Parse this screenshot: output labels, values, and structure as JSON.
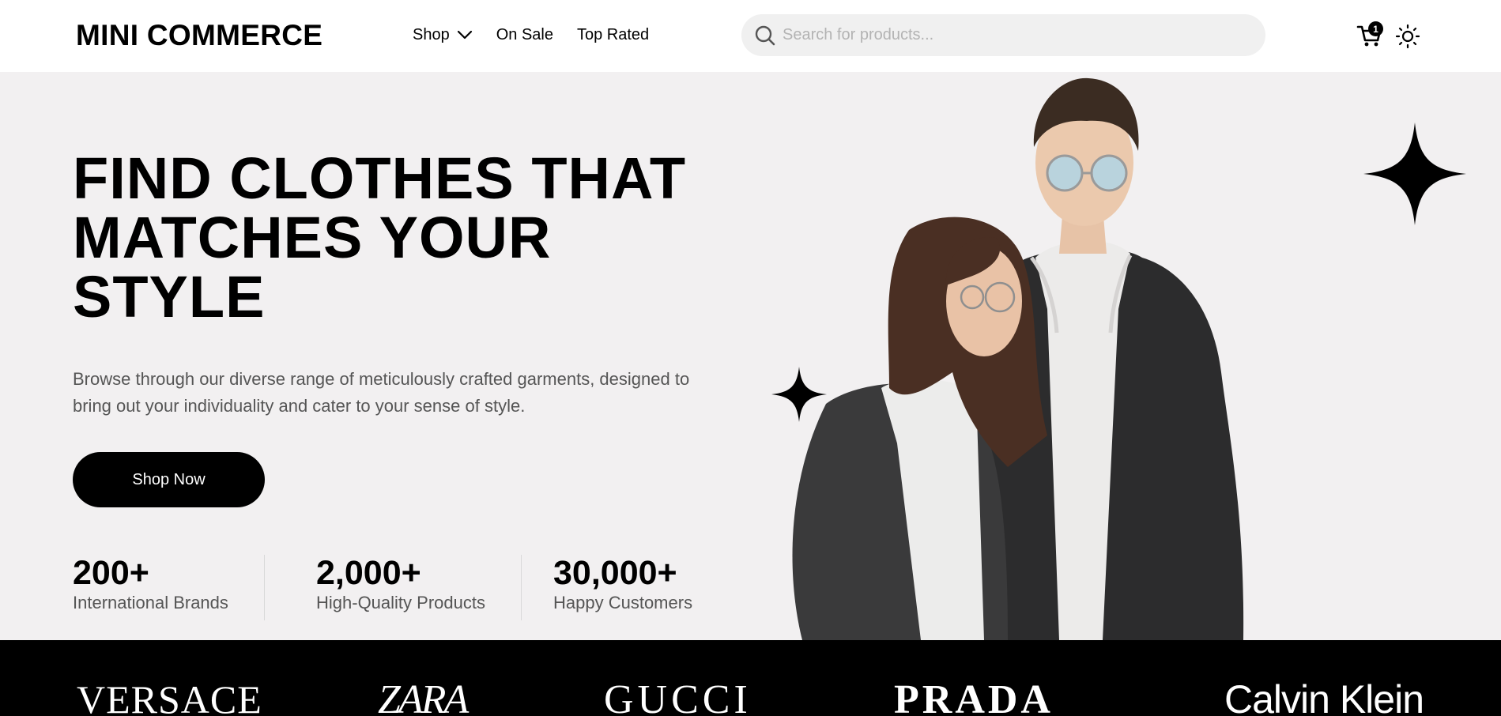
{
  "header": {
    "logo": "MINI COMMERCE",
    "nav": {
      "shop": "Shop",
      "on_sale": "On Sale",
      "top_rated": "Top Rated"
    },
    "search": {
      "placeholder": "Search for products...",
      "value": ""
    },
    "cart_count": "1",
    "icons": [
      "chevron-down-icon",
      "search-icon",
      "cart-icon",
      "sun-icon"
    ]
  },
  "hero": {
    "title": "FIND CLOTHES THAT MATCHES YOUR STYLE",
    "description": "Browse through our diverse range of meticulously crafted garments, designed to bring out your individuality and cater to your sense of style.",
    "cta_label": "Shop Now",
    "stats": [
      {
        "value": "200+",
        "label": "International Brands"
      },
      {
        "value": "2,000+",
        "label": "High-Quality Products"
      },
      {
        "value": "30,000+",
        "label": "Happy Customers"
      }
    ],
    "decorations": [
      "sparkle-icon",
      "sparkle-icon"
    ]
  },
  "brands": [
    "VERSACE",
    "ZARA",
    "GUCCI",
    "PRADA",
    "Calvin Klein"
  ],
  "colors": {
    "hero_background": "#f2f0f1",
    "primary": "#000000",
    "search_background": "#f0f0f0",
    "muted_text": "#555555"
  }
}
